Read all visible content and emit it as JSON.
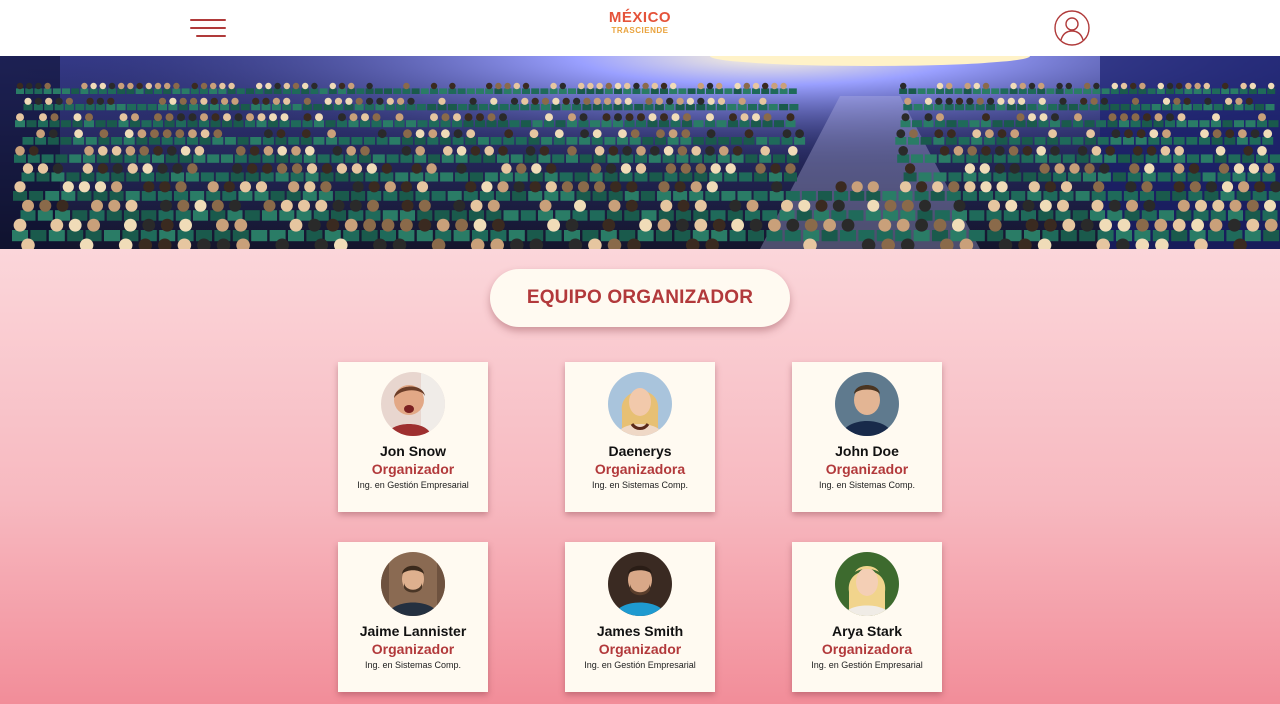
{
  "header": {
    "logo_line1": "MÉXICO",
    "logo_line2": "TRASCIENDE",
    "menu_icon": "hamburger-menu-icon",
    "user_icon": "user-profile-icon"
  },
  "section": {
    "title": "EQUIPO ORGANIZADOR"
  },
  "team": [
    {
      "name": "Jon Snow",
      "role": "Organizador",
      "degree": "Ing. en Gestión Empresarial"
    },
    {
      "name": "Daenerys",
      "role": "Organizadora",
      "degree": "Ing. en Sistemas Comp."
    },
    {
      "name": "John Doe",
      "role": "Organizador",
      "degree": "Ing. en Sistemas Comp."
    },
    {
      "name": "Jaime Lannister",
      "role": "Organizador",
      "degree": "Ing. en Sistemas Comp."
    },
    {
      "name": "James Smith",
      "role": "Organizador",
      "degree": "Ing. en Gestión Empresarial"
    },
    {
      "name": "Arya Stark",
      "role": "Organizadora",
      "degree": "Ing. en Gestión Empresarial"
    }
  ],
  "colors": {
    "accent": "#b2393b",
    "card_bg": "#fffaf1",
    "gradient_top": "#fbd6da",
    "gradient_bottom": "#f28d99"
  }
}
